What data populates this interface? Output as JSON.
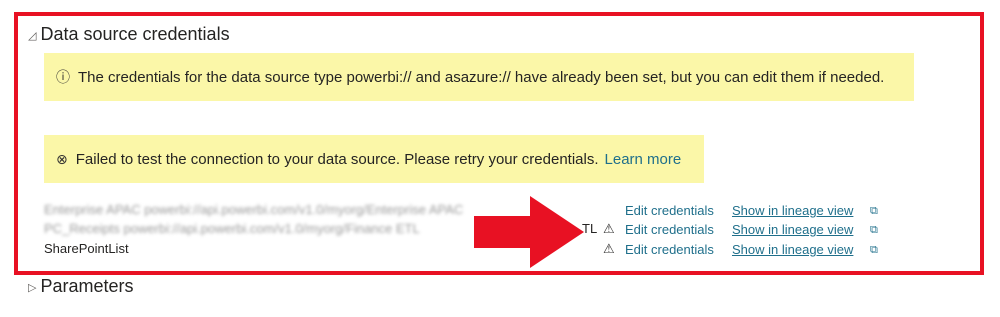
{
  "sections": {
    "credentials_title": "Data source credentials",
    "credentials_toggle": "◿",
    "parameters_title": "Parameters",
    "parameters_toggle": "▷"
  },
  "info_banner": {
    "icon": "ⓘ",
    "text": "The credentials for the data source type powerbi:// and asazure:// have already been set, but you can edit them if needed."
  },
  "error_banner": {
    "icon": "⊗",
    "text": "Failed to test the connection to your data source. Please retry your credentials.",
    "link": "Learn more"
  },
  "datasources": [
    {
      "name": "Enterprise APAC powerbi://api.powerbi.com/v1.0/myorg/Enterprise APAC",
      "blurred": true,
      "warning": false,
      "suffix": ""
    },
    {
      "name": "PC_Receipts powerbi://api.powerbi.com/v1.0/myorg/Finance ETL",
      "blurred": true,
      "warning": true,
      "suffix": "TL"
    },
    {
      "name": "SharePointList",
      "blurred": false,
      "warning": true,
      "suffix": ""
    }
  ],
  "row_actions": {
    "edit": "Edit credentials",
    "lineage": "Show in lineage view",
    "warning_icon": "⚠",
    "external_icon": "⧉"
  },
  "colors": {
    "frame": "#e81123",
    "arrow": "#e81123",
    "banner_bg": "#fbf7a8",
    "link": "#1f6f8b"
  }
}
